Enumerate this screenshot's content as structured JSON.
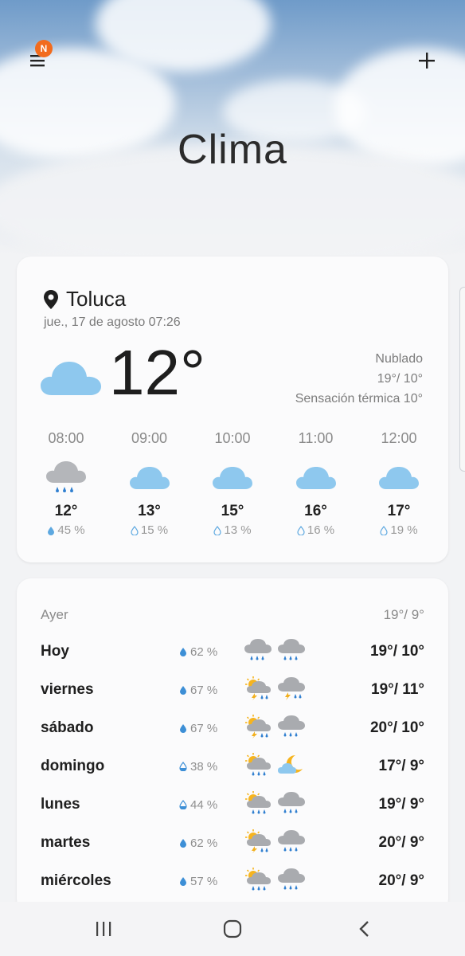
{
  "header": {
    "title": "Clima",
    "menu_icon": "menu-icon",
    "badge": "N",
    "add_icon": "plus-icon",
    "accent_color": "#f26b1d"
  },
  "current": {
    "location": "Toluca",
    "datetime": "jue., 17 de agosto 07:26",
    "temperature": "12°",
    "condition": "Nublado",
    "high_low": "19°/ 10°",
    "feels_like": "Sensación térmica 10°"
  },
  "hourly": [
    {
      "time": "08:00",
      "icon": "rain-cloud-icon",
      "temp": "12°",
      "precip": "45 %"
    },
    {
      "time": "09:00",
      "icon": "cloud-icon",
      "temp": "13°",
      "precip": "15 %"
    },
    {
      "time": "10:00",
      "icon": "cloud-icon",
      "temp": "15°",
      "precip": "13 %"
    },
    {
      "time": "11:00",
      "icon": "cloud-icon",
      "temp": "16°",
      "precip": "16 %"
    },
    {
      "time": "12:00",
      "icon": "cloud-icon",
      "temp": "17°",
      "precip": "19 %"
    }
  ],
  "daily": {
    "yesterday": {
      "day": "Ayer",
      "high_low": "19°/ 9°"
    },
    "rows": [
      {
        "day": "Hoy",
        "precip": "62 %",
        "icon_day": "rain-cloud-icon",
        "icon_night": "rain-cloud-icon",
        "high_low": "19°/ 10°"
      },
      {
        "day": "viernes",
        "precip": "67 %",
        "icon_day": "sun-thunderstorm-icon",
        "icon_night": "thunderstorm-icon",
        "high_low": "19°/ 11°"
      },
      {
        "day": "sábado",
        "precip": "67 %",
        "icon_day": "sun-thunderstorm-icon",
        "icon_night": "rain-cloud-icon",
        "high_low": "20°/ 10°"
      },
      {
        "day": "domingo",
        "precip": "38 %",
        "icon_day": "sun-rain-icon",
        "icon_night": "moon-cloud-icon",
        "high_low": "17°/ 9°"
      },
      {
        "day": "lunes",
        "precip": "44 %",
        "icon_day": "sun-rain-icon",
        "icon_night": "rain-cloud-icon",
        "high_low": "19°/ 9°"
      },
      {
        "day": "martes",
        "precip": "62 %",
        "icon_day": "sun-thunderstorm-icon",
        "icon_night": "rain-cloud-icon",
        "high_low": "20°/ 9°"
      },
      {
        "day": "miércoles",
        "precip": "57 %",
        "icon_day": "sun-rain-icon",
        "icon_night": "rain-cloud-icon",
        "high_low": "20°/ 9°"
      }
    ]
  },
  "navbar": {
    "recents_icon": "recents-icon",
    "home_icon": "home-icon",
    "back_icon": "back-icon"
  }
}
